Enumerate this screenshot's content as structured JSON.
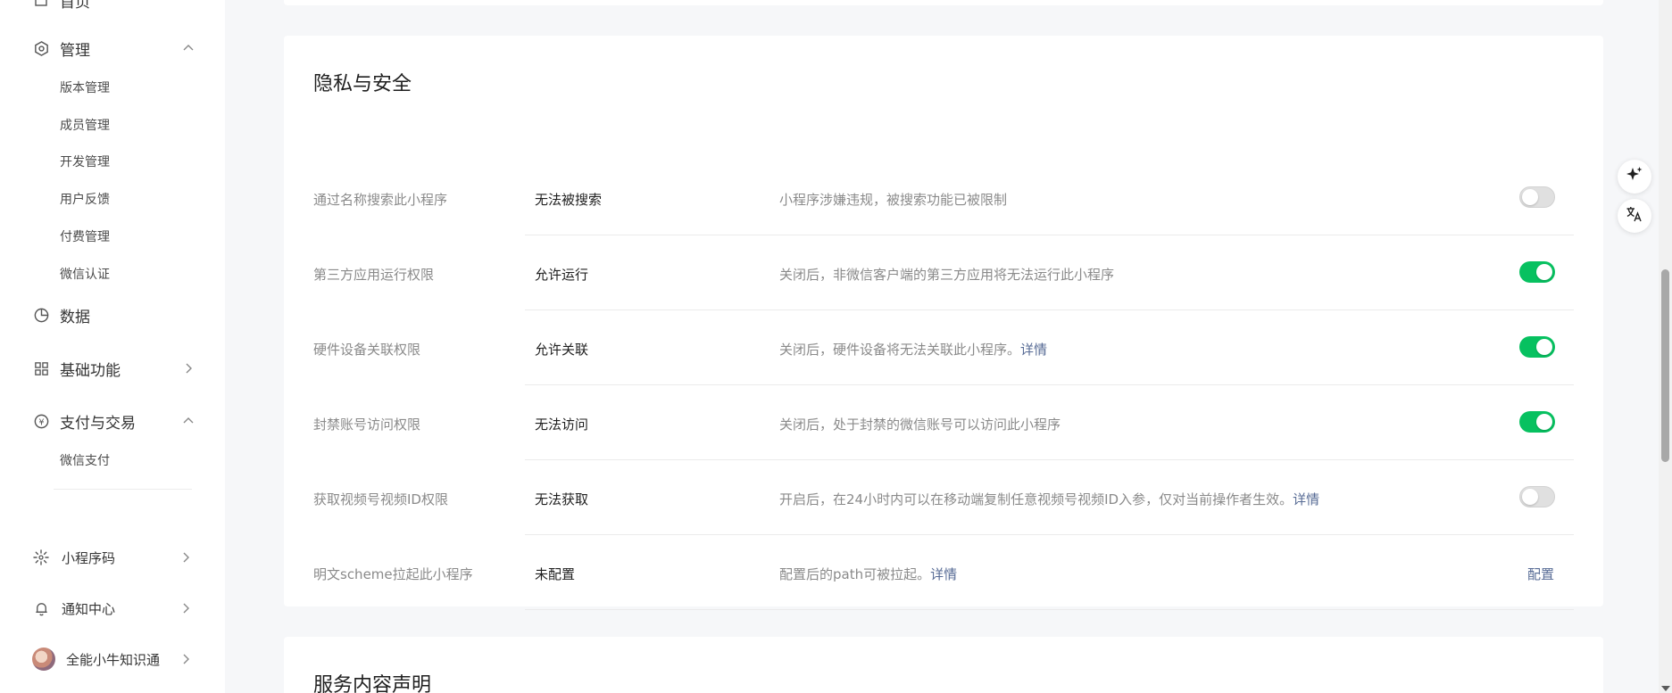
{
  "sidebar": {
    "partial_top_label": "首页",
    "groups": [
      {
        "label": "管理",
        "icon": "settings-hex-icon",
        "expanded": true
      },
      {
        "label": "数据",
        "icon": "pie-chart-icon"
      },
      {
        "label": "基础功能",
        "icon": "grid-icon",
        "expanded": false
      },
      {
        "label": "支付与交易",
        "icon": "yen-circle-icon",
        "expanded": true
      }
    ],
    "management_items": [
      "版本管理",
      "成员管理",
      "开发管理",
      "用户反馈",
      "付费管理",
      "微信认证"
    ],
    "payment_items": [
      "微信支付"
    ],
    "bottom_items": [
      {
        "label": "小程序码",
        "icon": "mini-program-code-icon"
      },
      {
        "label": "通知中心",
        "icon": "bell-icon"
      },
      {
        "label": "全能小牛知识通",
        "icon": "avatar"
      }
    ]
  },
  "privacy": {
    "title": "隐私与安全",
    "rows": [
      {
        "name": "通过名称搜索此小程序",
        "value": "无法被搜索",
        "desc": "小程序涉嫌违规，被搜索功能已被限制",
        "link": "",
        "toggle": "off"
      },
      {
        "name": "第三方应用运行权限",
        "value": "允许运行",
        "desc": "关闭后，非微信客户端的第三方应用将无法运行此小程序",
        "link": "",
        "toggle": "on"
      },
      {
        "name": "硬件设备关联权限",
        "value": "允许关联",
        "desc": "关闭后，硬件设备将无法关联此小程序。",
        "link": "详情",
        "toggle": "on"
      },
      {
        "name": "封禁账号访问权限",
        "value": "无法访问",
        "desc": "关闭后，处于封禁的微信账号可以访问此小程序",
        "link": "",
        "toggle": "on"
      },
      {
        "name": "获取视频号视频ID权限",
        "value": "无法获取",
        "desc": "开启后，在24小时内可以在移动端复制任意视频号视频ID入参，仅对当前操作者生效。",
        "link": "详情",
        "toggle": "off"
      },
      {
        "name": "明文scheme拉起此小程序",
        "value": "未配置",
        "desc": "配置后的path可被拉起。",
        "link": "详情",
        "action": "配置"
      }
    ]
  },
  "service": {
    "title": "服务内容声明"
  },
  "colors": {
    "accent_green": "#07c160",
    "link_blue": "#576b95"
  }
}
